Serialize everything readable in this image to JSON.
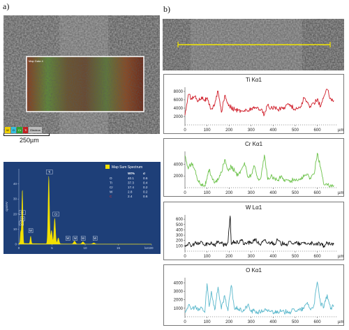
{
  "panel_a": {
    "label": "a)",
    "scale_bar": "250µm",
    "map_box_title": "Map Data 4",
    "legend_items": [
      {
        "label": "W",
        "color": "#f0d000"
      },
      {
        "label": "O",
        "color": "#35c0e0"
      },
      {
        "label": "Cr",
        "color": "#32a032"
      },
      {
        "label": "Ti",
        "color": "#c22020"
      },
      {
        "label": "Electron",
        "color": "#bbbbbb"
      }
    ]
  },
  "panel_b": {
    "label": "b)"
  },
  "colors": {
    "spectrum_bg": "#1e3f78",
    "spectrum_fill": "#f3e000",
    "ti": "#d01e2a",
    "cr": "#6cc24a",
    "w": "#111111",
    "o": "#5ab8cc",
    "scanline": "#f2e600"
  },
  "chart_data": [
    {
      "type": "area",
      "title": "Map Sum Spectrum",
      "ylabel": "cps/eV",
      "xlabel": "keV",
      "xlim": [
        0,
        20
      ],
      "ylim": [
        0,
        50
      ],
      "x_ticks": [
        "0",
        "5",
        "10",
        "15",
        "20"
      ],
      "y_ticks": [
        "0",
        "10",
        "20",
        "30",
        "40"
      ],
      "table_headers": [
        "",
        "Wt%",
        "σ"
      ],
      "table_rows": [
        {
          "el": "O",
          "wt": "40.1",
          "sigma": "0.6"
        },
        {
          "el": "Ti",
          "wt": "37.3",
          "sigma": "0.4"
        },
        {
          "el": "Cr",
          "wt": "17.4",
          "sigma": "0.2"
        },
        {
          "el": "W",
          "wt": "2.8",
          "sigma": "0.2"
        },
        {
          "el": "C",
          "wt": "2.4",
          "sigma": "0.6"
        }
      ],
      "peaks": [
        {
          "x": 0.28,
          "y": 8
        },
        {
          "x": 0.45,
          "y": 12
        },
        {
          "x": 0.52,
          "y": 16
        },
        {
          "x": 0.57,
          "y": 18
        },
        {
          "x": 1.78,
          "y": 5
        },
        {
          "x": 4.51,
          "y": 45
        },
        {
          "x": 4.93,
          "y": 9
        },
        {
          "x": 5.41,
          "y": 17
        },
        {
          "x": 5.95,
          "y": 4
        },
        {
          "x": 8.4,
          "y": 2
        },
        {
          "x": 9.67,
          "y": 1.5
        },
        {
          "x": 11.3,
          "y": 0.8
        }
      ],
      "peak_labels": [
        {
          "label": "Cr",
          "x": 0.5,
          "y": 20
        },
        {
          "label": "O",
          "x": 0.55,
          "y": 16
        },
        {
          "label": "C",
          "x": 0.4,
          "y": 13
        },
        {
          "label": "W",
          "x": 1.8,
          "y": 8
        },
        {
          "label": "Ti",
          "x": 4.6,
          "y": 47
        },
        {
          "label": "Cr",
          "x": 5.6,
          "y": 19
        },
        {
          "label": "W",
          "x": 7.4,
          "y": 3
        },
        {
          "label": "W",
          "x": 8.5,
          "y": 3
        },
        {
          "label": "W",
          "x": 9.7,
          "y": 3
        },
        {
          "label": "W",
          "x": 11.5,
          "y": 3
        }
      ]
    },
    {
      "type": "line",
      "title": "Ti Kα1",
      "xlabel": "µm",
      "x_ticks": [
        0,
        100,
        200,
        300,
        400,
        500,
        600
      ],
      "y_ticks": [
        2000,
        4000,
        6000,
        8000
      ],
      "ylim": [
        0,
        9000
      ],
      "xlim": [
        0,
        690
      ],
      "series": [
        {
          "name": "Ti Kα1",
          "x": [
            0,
            15,
            30,
            45,
            60,
            75,
            90,
            100,
            110,
            120,
            135,
            150,
            165,
            180,
            195,
            210,
            225,
            240,
            255,
            270,
            285,
            300,
            315,
            330,
            345,
            360,
            375,
            390,
            405,
            420,
            435,
            450,
            465,
            480,
            495,
            510,
            525,
            540,
            555,
            570,
            585,
            600,
            615,
            630,
            645,
            660,
            675
          ],
          "y": [
            2300,
            7200,
            6400,
            6800,
            5800,
            6700,
            6000,
            6300,
            4800,
            3800,
            4900,
            8100,
            3000,
            7000,
            5200,
            4100,
            3700,
            3400,
            3300,
            3500,
            3300,
            4000,
            3900,
            4200,
            3700,
            2400,
            4800,
            3900,
            4300,
            3600,
            3900,
            4200,
            5000,
            4700,
            3800,
            3900,
            4400,
            6400,
            5300,
            4200,
            5200,
            6200,
            4400,
            6800,
            8500,
            6400,
            5800
          ]
        }
      ]
    },
    {
      "type": "line",
      "title": "Cr Kα1",
      "xlabel": "µm",
      "x_ticks": [
        0,
        100,
        200,
        300,
        400,
        500,
        600
      ],
      "y_ticks": [
        2000,
        4000
      ],
      "ylim": [
        0,
        6200
      ],
      "xlim": [
        0,
        690
      ],
      "series": [
        {
          "name": "Cr Kα1",
          "x": [
            0,
            15,
            30,
            45,
            60,
            75,
            90,
            100,
            110,
            120,
            135,
            150,
            165,
            180,
            195,
            210,
            225,
            240,
            255,
            270,
            285,
            300,
            315,
            330,
            345,
            360,
            375,
            390,
            405,
            420,
            435,
            450,
            465,
            480,
            495,
            510,
            525,
            540,
            555,
            570,
            585,
            600,
            615,
            630,
            645,
            660,
            675
          ],
          "y": [
            5500,
            3200,
            4300,
            3000,
            1200,
            600,
            400,
            1500,
            3100,
            2000,
            800,
            1300,
            2600,
            4800,
            3100,
            3600,
            2900,
            2000,
            3000,
            4300,
            1800,
            2200,
            3700,
            1500,
            1800,
            5600,
            1400,
            2000,
            1600,
            1200,
            1900,
            1400,
            1300,
            1100,
            1500,
            1200,
            1600,
            1900,
            2300,
            1500,
            2300,
            5900,
            3500,
            500,
            400,
            500,
            400
          ]
        }
      ]
    },
    {
      "type": "line",
      "title": "W Lα1",
      "xlabel": "µm",
      "x_ticks": [
        0,
        100,
        200,
        300,
        400,
        500,
        600
      ],
      "y_ticks": [
        100,
        200,
        300,
        400,
        500,
        600
      ],
      "ylim": [
        0,
        680
      ],
      "xlim": [
        0,
        690
      ],
      "series": [
        {
          "name": "W Lα1",
          "x": [
            0,
            15,
            30,
            45,
            60,
            75,
            90,
            100,
            110,
            120,
            135,
            150,
            165,
            180,
            195,
            205,
            210,
            225,
            240,
            255,
            270,
            285,
            300,
            315,
            330,
            345,
            360,
            375,
            390,
            405,
            420,
            435,
            450,
            465,
            480,
            495,
            510,
            525,
            540,
            555,
            570,
            585,
            600,
            615,
            630,
            645,
            660,
            675
          ],
          "y": [
            110,
            140,
            90,
            160,
            120,
            180,
            100,
            150,
            130,
            170,
            110,
            190,
            140,
            120,
            160,
            660,
            130,
            180,
            150,
            220,
            120,
            170,
            140,
            230,
            160,
            130,
            200,
            150,
            170,
            140,
            210,
            130,
            160,
            120,
            180,
            140,
            150,
            120,
            170,
            130,
            160,
            110,
            140,
            120,
            100,
            150,
            120,
            130
          ]
        }
      ]
    },
    {
      "type": "line",
      "title": "O Kα1",
      "xlabel": "µm",
      "x_ticks": [
        0,
        100,
        200,
        300,
        400,
        500,
        600
      ],
      "y_ticks": [
        1000,
        2000,
        3000,
        4000
      ],
      "ylim": [
        0,
        4600
      ],
      "xlim": [
        0,
        690
      ],
      "series": [
        {
          "name": "O Kα1",
          "x": [
            0,
            15,
            30,
            45,
            60,
            75,
            90,
            100,
            110,
            120,
            135,
            150,
            165,
            180,
            195,
            210,
            225,
            240,
            255,
            270,
            285,
            300,
            315,
            330,
            345,
            360,
            375,
            390,
            405,
            420,
            435,
            450,
            465,
            480,
            495,
            510,
            525,
            540,
            555,
            570,
            585,
            600,
            615,
            630,
            645,
            660,
            675
          ],
          "y": [
            600,
            1300,
            900,
            1200,
            700,
            1100,
            500,
            3900,
            1200,
            3000,
            800,
            3500,
            900,
            2500,
            700,
            3700,
            900,
            1000,
            700,
            800,
            1400,
            600,
            700,
            500,
            600,
            800,
            600,
            700,
            500,
            700,
            600,
            500,
            700,
            500,
            900,
            700,
            800,
            1000,
            1700,
            800,
            1400,
            4100,
            1500,
            1100,
            2600,
            900,
            1300
          ]
        }
      ]
    }
  ]
}
